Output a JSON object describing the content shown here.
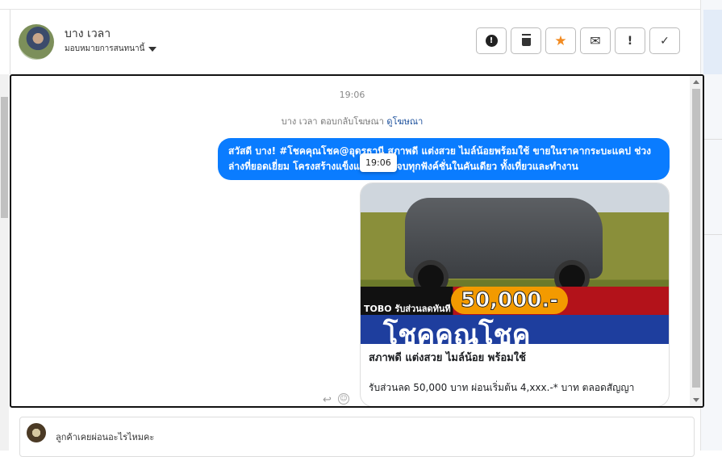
{
  "header": {
    "name": "บาง เวลา",
    "assign_label": "มอบหมายการสนทนานี้"
  },
  "toolbar": [
    {
      "name": "spam-icon",
      "glyph": "⬣"
    },
    {
      "name": "trash-icon",
      "glyph": "🗑"
    },
    {
      "name": "star-icon",
      "glyph": "★"
    },
    {
      "name": "mail-icon",
      "glyph": "✉"
    },
    {
      "name": "important-icon",
      "glyph": "!"
    },
    {
      "name": "check-icon",
      "glyph": "✓"
    }
  ],
  "chat": {
    "timestamp": "19:06",
    "system_text": "บาง เวลา ตอบกลับโฆษณา",
    "system_link": "ดูโฆษณา",
    "message": "สวัสดี บาง! #โชคคุณโชค@อุดรธานี สภาพดี แต่งสวย ไมล์น้อยพร้อมใช้ ขายในราคากระบะแคป ช่วงล่างที่ยอดเยี่ยม โครงสร้างแข็งแกร่ง ครบจบทุกฟังค์ชั่นในคันเดียว ทั้งเที่ยวและทำงาน",
    "tooltip": "19:06",
    "ad": {
      "banner_label": "TOBO รับส่วนลดทันที",
      "banner_price": "50,000.-",
      "banner_big": "โชคคุณโชค",
      "title": "สภาพดี แต่งสวย ไมล์น้อย พร้อมใช้",
      "description": "รับส่วนลด 50,000 บาท ผ่อนเริ่มต้น 4,xxx.-* บาท ตลอดสัญญา"
    }
  },
  "compose": {
    "text": "ลูกค้าเคยผ่อนอะไรไหมคะ"
  },
  "colors": {
    "accent": "#0a7cff",
    "star": "#f28b22"
  }
}
